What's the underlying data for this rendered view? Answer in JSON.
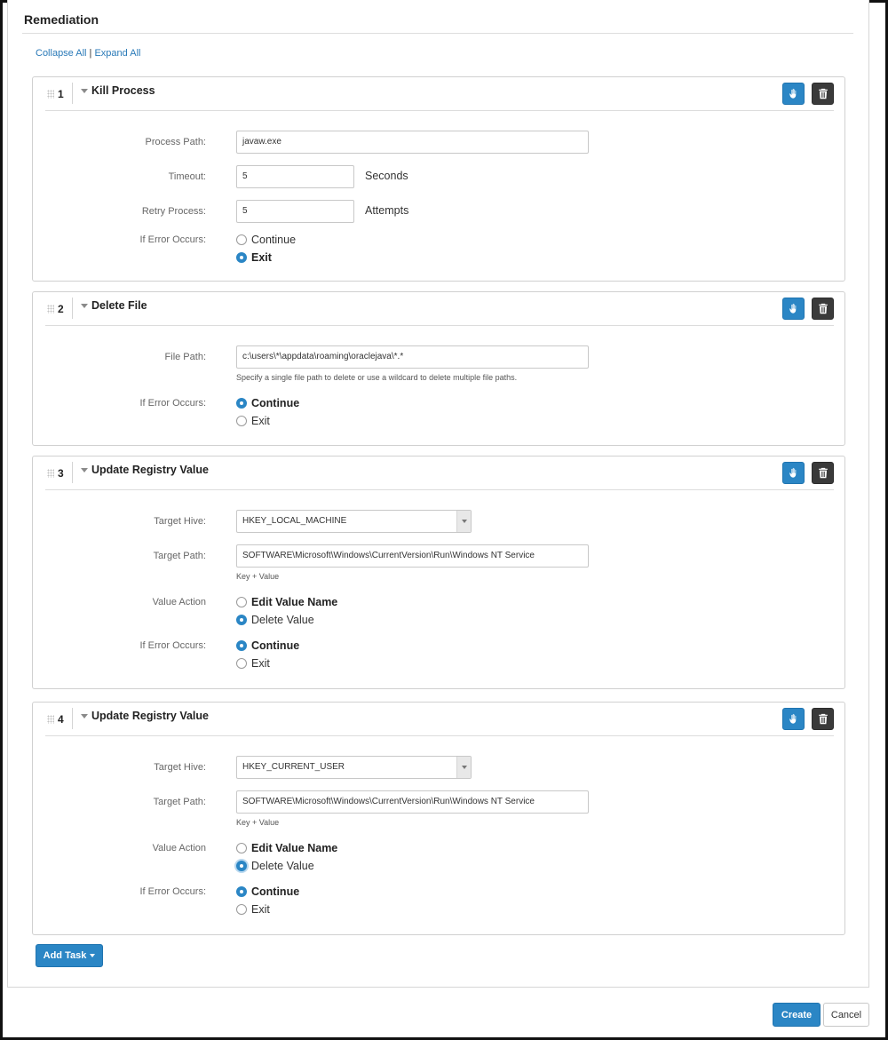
{
  "section": {
    "title": "Remediation",
    "collapse_all": "Collapse All",
    "separator": "|",
    "expand_all": "Expand All"
  },
  "icons": {
    "move": "hand-icon",
    "delete": "trash-icon"
  },
  "colors": {
    "primary": "#2b86c5",
    "dark_button": "#3a3a3a",
    "link": "#2a7ab8"
  },
  "tasks": [
    {
      "number": "1",
      "title": "Kill Process",
      "process_path_label": "Process Path:",
      "process_path_value": "javaw.exe",
      "timeout_label": "Timeout:",
      "timeout_value": "5",
      "timeout_unit": "Seconds",
      "retry_label": "Retry Process:",
      "retry_value": "5",
      "retry_unit": "Attempts",
      "error_label": "If Error Occurs:",
      "option_continue": "Continue",
      "option_exit": "Exit",
      "selected": "Exit"
    },
    {
      "number": "2",
      "title": "Delete File",
      "file_path_label": "File Path:",
      "file_path_value": "c:\\users\\*\\appdata\\roaming\\oraclejava\\*.*",
      "file_path_help": "Specify a single file path to delete or use a wildcard to delete multiple file paths.",
      "error_label": "If Error Occurs:",
      "option_continue": "Continue",
      "option_exit": "Exit",
      "selected": "Continue"
    },
    {
      "number": "3",
      "title": "Update Registry Value",
      "hive_label": "Target Hive:",
      "hive_value": "HKEY_LOCAL_MACHINE",
      "path_label": "Target Path:",
      "path_value": "SOFTWARE\\Microsoft\\Windows\\CurrentVersion\\Run\\Windows NT Service",
      "path_help": "Key + Value",
      "action_label": "Value Action",
      "action_edit": "Edit Value Name",
      "action_delete": "Delete Value",
      "action_selected": "Delete Value",
      "error_label": "If Error Occurs:",
      "option_continue": "Continue",
      "option_exit": "Exit",
      "selected": "Continue"
    },
    {
      "number": "4",
      "title": "Update Registry Value",
      "hive_label": "Target Hive:",
      "hive_value": "HKEY_CURRENT_USER",
      "path_label": "Target Path:",
      "path_value": "SOFTWARE\\Microsoft\\Windows\\CurrentVersion\\Run\\Windows NT Service",
      "path_help": "Key + Value",
      "action_label": "Value Action",
      "action_edit": "Edit Value Name",
      "action_delete": "Delete Value",
      "action_selected": "Delete Value",
      "error_label": "If Error Occurs:",
      "option_continue": "Continue",
      "option_exit": "Exit",
      "selected": "Continue"
    }
  ],
  "footer": {
    "add_task": "Add Task",
    "create": "Create",
    "cancel": "Cancel"
  }
}
